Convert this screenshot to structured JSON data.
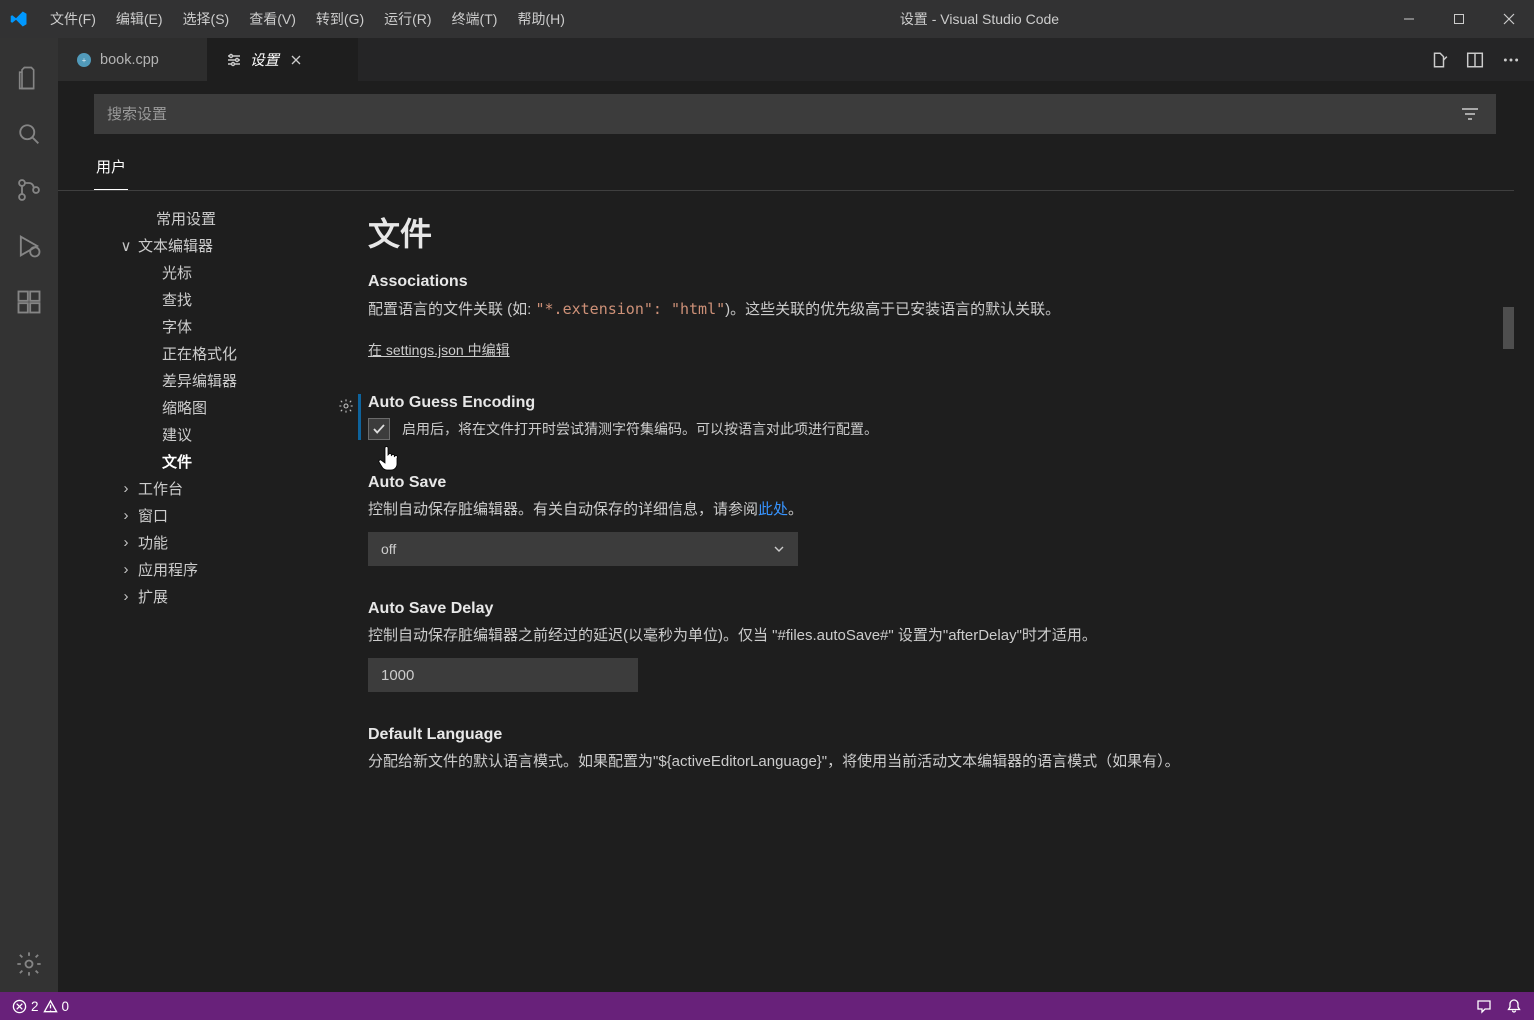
{
  "titlebar": {
    "title": "设置 - Visual Studio Code",
    "menu": [
      "文件(F)",
      "编辑(E)",
      "选择(S)",
      "查看(V)",
      "转到(G)",
      "运行(R)",
      "终端(T)",
      "帮助(H)"
    ]
  },
  "tabs": {
    "items": [
      {
        "label": "book.cpp",
        "icon": "cpp",
        "active": false
      },
      {
        "label": "设置",
        "icon": "settings",
        "active": true
      }
    ]
  },
  "search": {
    "placeholder": "搜索设置"
  },
  "scope": {
    "user": "用户"
  },
  "toc": {
    "common": "常用设置",
    "textEditor": "文本编辑器",
    "children": [
      "光标",
      "查找",
      "字体",
      "正在格式化",
      "差异编辑器",
      "缩略图",
      "建议",
      "文件"
    ],
    "workbench": "工作台",
    "window": "窗口",
    "features": "功能",
    "application": "应用程序",
    "extensions": "扩展"
  },
  "section": {
    "title": "文件",
    "associations": {
      "title": "Associations",
      "desc_pre": "配置语言的文件关联 (如: ",
      "desc_code": "\"*.extension\": \"html\"",
      "desc_post": ")。这些关联的优先级高于已安装语言的默认关联。",
      "edit_link": "在 settings.json 中编辑"
    },
    "autoGuess": {
      "title": "Auto Guess Encoding",
      "label": "启用后，将在文件打开时尝试猜测字符集编码。可以按语言对此项进行配置。",
      "checked": true
    },
    "autoSave": {
      "title": "Auto Save",
      "desc_pre": "控制自动保存脏编辑器。有关自动保存的详细信息，请参阅",
      "link": "此处",
      "desc_post": "。",
      "value": "off"
    },
    "autoSaveDelay": {
      "title": "Auto Save Delay",
      "desc": "控制自动保存脏编辑器之前经过的延迟(以毫秒为单位)。仅当 \"#files.autoSave#\" 设置为\"afterDelay\"时才适用。",
      "value": "1000"
    },
    "defaultLanguage": {
      "title": "Default Language",
      "desc": "分配给新文件的默认语言模式。如果配置为\"${activeEditorLanguage}\"，将使用当前活动文本编辑器的语言模式（如果有）。"
    }
  },
  "status": {
    "errors": "2",
    "warnings": "0"
  }
}
